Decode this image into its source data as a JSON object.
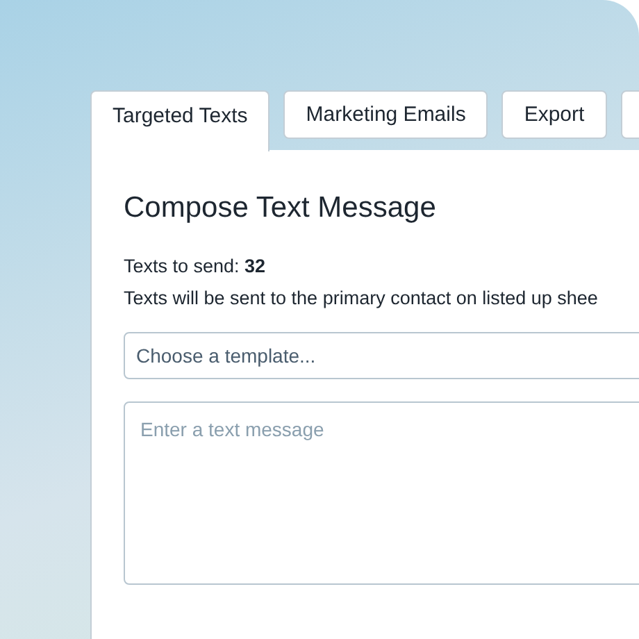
{
  "tabs": [
    {
      "label": "Targeted Texts",
      "selected": true
    },
    {
      "label": "Marketing Emails",
      "selected": false
    },
    {
      "label": "Export",
      "selected": false
    },
    {
      "selected": false
    }
  ],
  "panel": {
    "heading": "Compose Text Message",
    "count_label": "Texts to send:",
    "count": "32",
    "note": "Texts will be sent to the primary contact on listed up shee",
    "template_select": {
      "placeholder": "Choose a template..."
    },
    "message": {
      "placeholder": "Enter a text message"
    }
  }
}
